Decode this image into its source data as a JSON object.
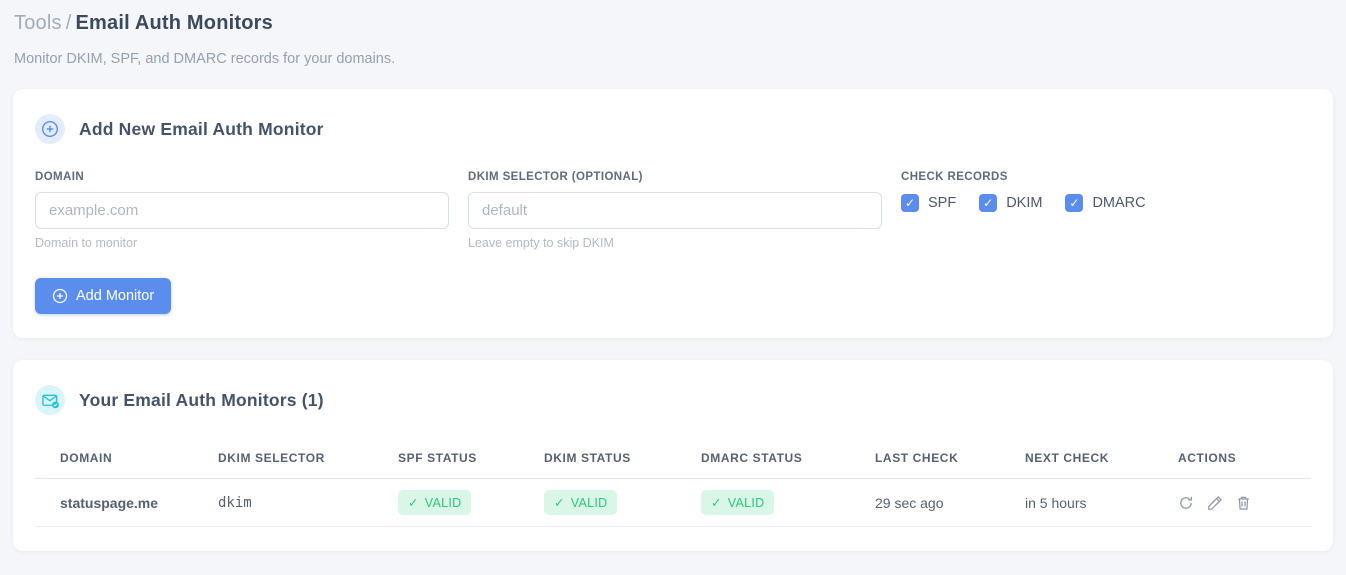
{
  "page": {
    "breadcrumb_parent": "Tools",
    "breadcrumb_separator": "/",
    "title": "Email Auth Monitors",
    "subtitle": "Monitor DKIM, SPF, and DMARC records for your domains."
  },
  "icons": {
    "check": "✓"
  },
  "colors": {
    "accent_blue": "#5a8dee",
    "accent_teal": "#25c1d4",
    "status_valid_text": "#2bc77c",
    "status_valid_bg": "#d9f6e7",
    "selector_pink": "#ee4c86",
    "page_background": "#f4f6f9"
  },
  "add_monitor_card": {
    "title": "Add New Email Auth Monitor",
    "domain_field": {
      "label": "DOMAIN",
      "placeholder": "example.com",
      "value": "",
      "helper": "Domain to monitor"
    },
    "dkim_field": {
      "label": "DKIM SELECTOR (OPTIONAL)",
      "placeholder": "default",
      "value": "",
      "helper": "Leave empty to skip DKIM"
    },
    "check_records": {
      "label": "CHECK RECORDS",
      "options": [
        {
          "label": "SPF",
          "checked": true
        },
        {
          "label": "DKIM",
          "checked": true
        },
        {
          "label": "DMARC",
          "checked": true
        }
      ]
    },
    "submit_label": "Add Monitor"
  },
  "monitors_card": {
    "title": "Your Email Auth Monitors (1)",
    "table": {
      "headers": [
        "DOMAIN",
        "DKIM SELECTOR",
        "SPF STATUS",
        "DKIM STATUS",
        "DMARC STATUS",
        "LAST CHECK",
        "NEXT CHECK",
        "ACTIONS"
      ],
      "rows": [
        {
          "domain": "statuspage.me",
          "dkim_selector": "dkim",
          "spf_status": "VALID",
          "dkim_status": "VALID",
          "dmarc_status": "VALID",
          "last_check": "29 sec ago",
          "next_check": "in 5 hours"
        }
      ]
    }
  }
}
